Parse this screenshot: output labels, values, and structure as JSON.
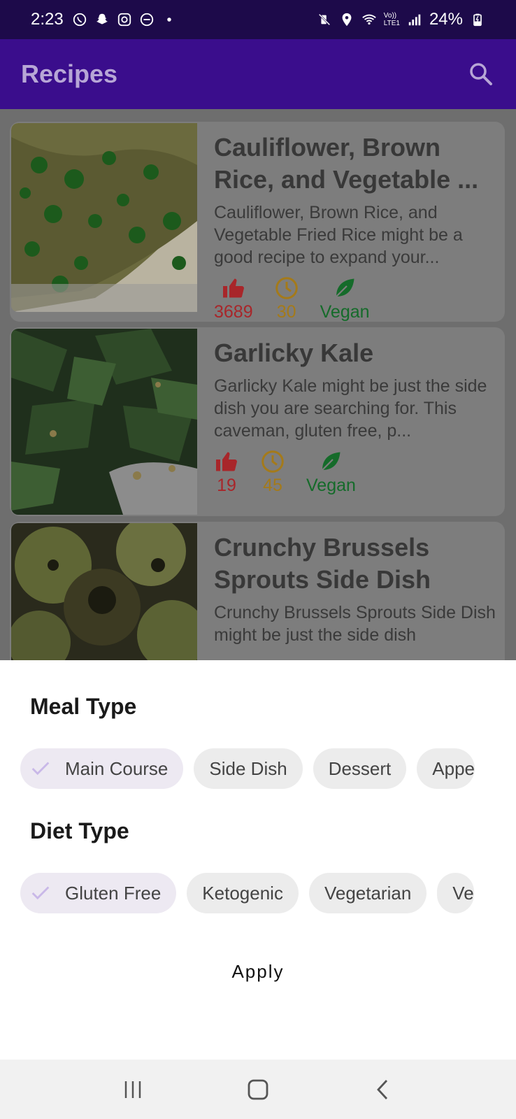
{
  "status_bar": {
    "time": "2:23",
    "left_icons": [
      "whatsapp-icon",
      "snapchat-icon",
      "instagram-icon",
      "dnd-icon",
      "dot-icon"
    ],
    "right_icons": [
      "mute-vibrate-icon",
      "location-icon",
      "wifi-icon",
      "volte-icon",
      "signal-icon",
      "battery-charging-icon"
    ],
    "battery": "24%",
    "network_label_line1": "Vo))",
    "network_label_line2": "LTE1"
  },
  "app_bar": {
    "title": "Recipes",
    "search_icon": "search-icon"
  },
  "recipes": [
    {
      "title": "Cauliflower, Brown\nRice, and Vegetable ...",
      "description": "Cauliflower, Brown Rice, and Vegetable Fried Rice might be a good recipe to expand your...",
      "likes": "3689",
      "minutes": "30",
      "diet": "Vegan"
    },
    {
      "title": "Garlicky Kale",
      "description": "Garlicky Kale might be just the side dish you are searching for. This caveman, gluten free, p...",
      "likes": "19",
      "minutes": "45",
      "diet": "Vegan"
    },
    {
      "title": "Crunchy Brussels\nSprouts Side Dish",
      "description": "Crunchy Brussels Sprouts Side Dish might be just the side dish"
    }
  ],
  "sheet": {
    "meal_type_heading": "Meal Type",
    "meal_types": [
      {
        "label": "Main Course",
        "selected": true
      },
      {
        "label": "Side Dish",
        "selected": false
      },
      {
        "label": "Dessert",
        "selected": false
      },
      {
        "label": "Appe",
        "selected": false
      }
    ],
    "diet_type_heading": "Diet Type",
    "diet_types": [
      {
        "label": "Gluten Free",
        "selected": true
      },
      {
        "label": "Ketogenic",
        "selected": false
      },
      {
        "label": "Vegetarian",
        "selected": false
      },
      {
        "label": "Ve",
        "selected": false
      }
    ],
    "apply_label": "Apply"
  },
  "colors": {
    "app_bar": "#3a0d8c",
    "status_bar": "#1d0a4a",
    "likes": "#a8262a",
    "time": "#a47a1a",
    "vegan": "#156b2a",
    "check": "#c9b8e8"
  }
}
